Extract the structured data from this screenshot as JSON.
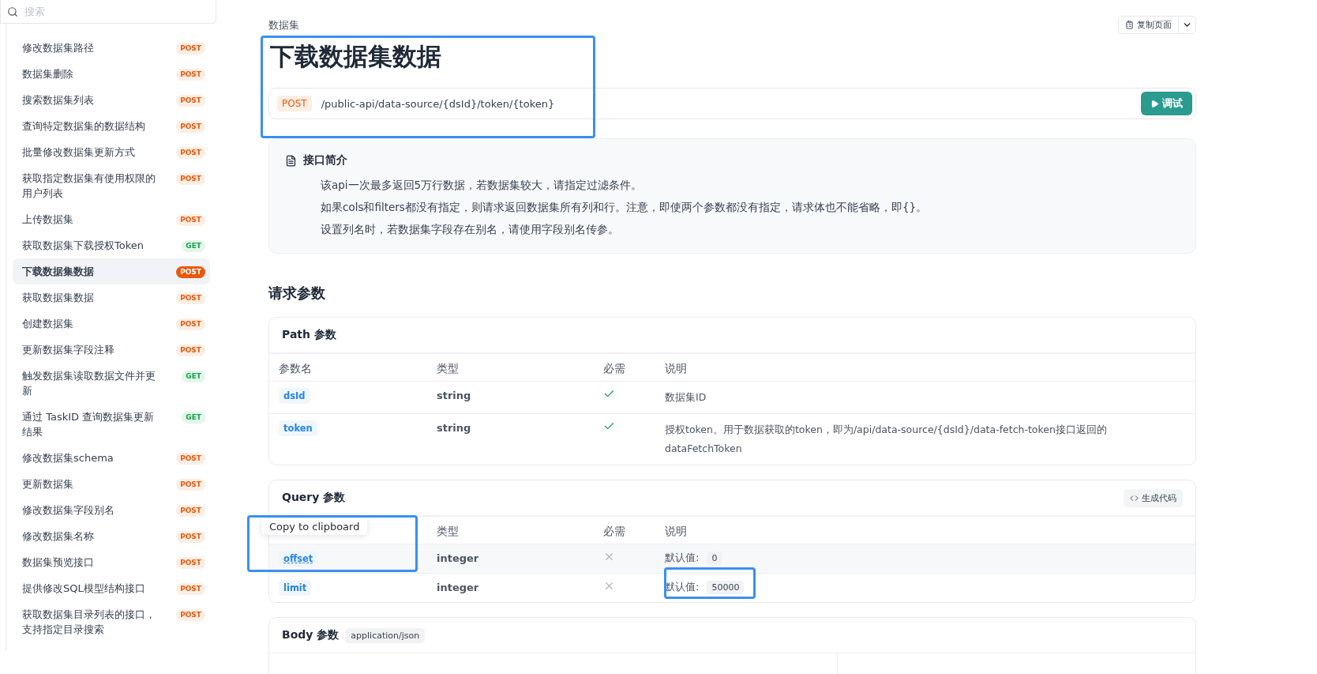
{
  "search": {
    "placeholder": "搜索"
  },
  "sidebar": {
    "items": [
      {
        "label": "修改数据集路径",
        "method": "POST",
        "kind": "post",
        "selected": false
      },
      {
        "label": "数据集删除",
        "method": "POST",
        "kind": "post",
        "selected": false
      },
      {
        "label": "搜索数据集列表",
        "method": "POST",
        "kind": "post",
        "selected": false
      },
      {
        "label": "查询特定数据集的数据结构",
        "method": "POST",
        "kind": "post",
        "selected": false
      },
      {
        "label": "批量修改数据集更新方式",
        "method": "POST",
        "kind": "post",
        "selected": false
      },
      {
        "label": "获取指定数据集有使用权限的用户列表",
        "method": "POST",
        "kind": "post",
        "selected": false
      },
      {
        "label": "上传数据集",
        "method": "POST",
        "kind": "post",
        "selected": false
      },
      {
        "label": "获取数据集下载授权Token",
        "method": "GET",
        "kind": "get",
        "selected": false
      },
      {
        "label": "下载数据集数据",
        "method": "POST",
        "kind": "post",
        "selected": true
      },
      {
        "label": "获取数据集数据",
        "method": "POST",
        "kind": "post",
        "selected": false
      },
      {
        "label": "创建数据集",
        "method": "POST",
        "kind": "post",
        "selected": false
      },
      {
        "label": "更新数据集字段注释",
        "method": "POST",
        "kind": "post",
        "selected": false
      },
      {
        "label": "触发数据集读取数据文件并更新",
        "method": "GET",
        "kind": "get",
        "selected": false
      },
      {
        "label": "通过 TaskID 查询数据集更新结果",
        "method": "GET",
        "kind": "get",
        "selected": false
      },
      {
        "label": "修改数据集schema",
        "method": "POST",
        "kind": "post",
        "selected": false
      },
      {
        "label": "更新数据集",
        "method": "POST",
        "kind": "post",
        "selected": false
      },
      {
        "label": "修改数据集字段别名",
        "method": "POST",
        "kind": "post",
        "selected": false
      },
      {
        "label": "修改数据集名称",
        "method": "POST",
        "kind": "post",
        "selected": false
      },
      {
        "label": "数据集预览接口",
        "method": "POST",
        "kind": "post",
        "selected": false
      },
      {
        "label": "提供修改SQL模型结构接口",
        "method": "POST",
        "kind": "post",
        "selected": false
      },
      {
        "label": "获取数据集目录列表的接口，支持指定目录搜索",
        "method": "POST",
        "kind": "post",
        "selected": false
      }
    ]
  },
  "breadcrumb": "数据集",
  "copy_page_button": "复制页面",
  "title": "下载数据集数据",
  "endpoint": {
    "method": "POST",
    "path": "/public-api/data-source/{dsId}/token/{token}",
    "try_button": "调试"
  },
  "intro": {
    "heading": "接口简介",
    "lines": [
      "该api一次最多返回5万行数据，若数据集较大，请指定过滤条件。",
      "如果cols和filters都没有指定，则请求返回数据集所有列和行。注意，即使两个参数都没有指定，请求体也不能省略，即{}。",
      "设置列名时，若数据集字段存在别名，请使用字段别名传参。"
    ]
  },
  "request_params_heading": "请求参数",
  "path_params": {
    "title": "Path 参数",
    "columns": [
      "参数名",
      "类型",
      "必需",
      "说明"
    ],
    "rows": [
      {
        "name": "dsId",
        "type": "string",
        "required": true,
        "description": "数据集ID",
        "highlighted": false
      },
      {
        "name": "token",
        "type": "string",
        "required": true,
        "description": "授权token。用于数据获取的token，即为/api/data-source/{dsId}/data-fetch-token接口返回的dataFetchToken",
        "highlighted": false
      }
    ]
  },
  "query_params": {
    "title": "Query 参数",
    "generate_code_button": "生成代码",
    "columns": [
      "类型",
      "必需",
      "说明"
    ],
    "tooltip": "Copy to clipboard",
    "rows": [
      {
        "name": "offset",
        "type": "integer",
        "required": false,
        "default_label": "默认值:",
        "default_value": "0",
        "highlighted": true
      },
      {
        "name": "limit",
        "type": "integer",
        "required": false,
        "default_label": "默认值:",
        "default_value": "50000",
        "highlighted": false
      }
    ]
  },
  "body_params": {
    "title": "Body 参数",
    "content_type": "application/json"
  }
}
